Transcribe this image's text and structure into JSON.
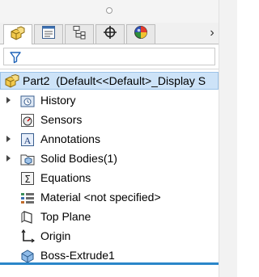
{
  "tabs": [
    {
      "name": "feature-manager",
      "icon": "part-tree-icon",
      "active": true
    },
    {
      "name": "property-manager",
      "icon": "property-list-icon",
      "active": false
    },
    {
      "name": "configuration-manager",
      "icon": "configuration-icon",
      "active": false
    },
    {
      "name": "dimxpert-manager",
      "icon": "crosshair-icon",
      "active": false
    },
    {
      "name": "display-manager",
      "icon": "appearance-sphere-icon",
      "active": false
    }
  ],
  "filter": {
    "icon": "filter-funnel-icon"
  },
  "root": {
    "label": "Part2  (Default<<Default>_Display S",
    "icon": "part-icon",
    "highlight": "#cde3f8"
  },
  "tree": [
    {
      "label": "History",
      "icon": "history-icon",
      "expandable": true
    },
    {
      "label": "Sensors",
      "icon": "sensors-icon",
      "expandable": false
    },
    {
      "label": "Annotations",
      "icon": "annotations-icon",
      "expandable": true
    },
    {
      "label": "Solid Bodies(1)",
      "icon": "solid-bodies-folder-icon",
      "expandable": true
    },
    {
      "label": "Equations",
      "icon": "equations-icon",
      "expandable": false
    },
    {
      "label": "Material <not specified>",
      "icon": "material-icon",
      "expandable": false
    },
    {
      "label": "Top Plane",
      "icon": "plane-icon",
      "expandable": false
    },
    {
      "label": "Origin",
      "icon": "origin-icon",
      "expandable": false
    },
    {
      "label": "Boss-Extrude1",
      "icon": "extrude-icon",
      "expandable": false
    }
  ],
  "rollback_bar_color": "#2a86c9"
}
